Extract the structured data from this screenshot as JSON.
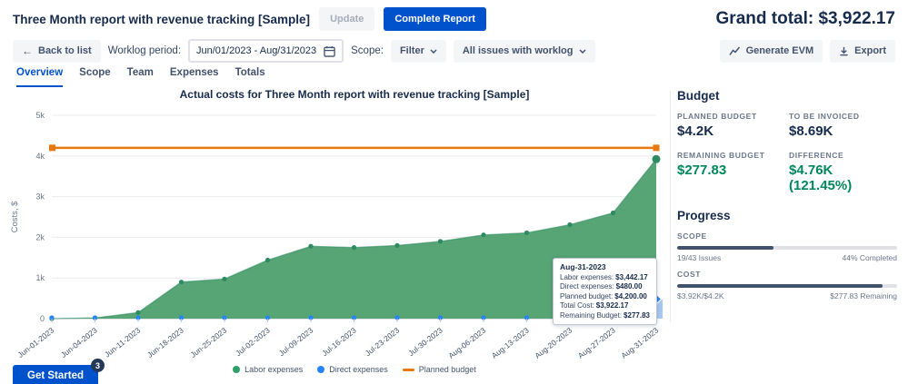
{
  "header": {
    "title": "Three Month report with revenue tracking [Sample]",
    "update_label": "Update",
    "complete_label": "Complete Report",
    "grand_total": "Grand total: $3,922.17"
  },
  "toolbar": {
    "back_label": "Back to list",
    "back_arrow": "←",
    "worklog_label": "Worklog period:",
    "worklog_value": "Jun/01/2023 - Aug/31/2023",
    "scope_label": "Scope:",
    "filter_value": "Filter",
    "issues_value": "All issues with worklog",
    "generate_evm_label": "Generate EVM",
    "export_label": "Export"
  },
  "tabs": [
    {
      "label": "Overview"
    },
    {
      "label": "Scope"
    },
    {
      "label": "Team"
    },
    {
      "label": "Expenses"
    },
    {
      "label": "Totals"
    }
  ],
  "chart_data": {
    "type": "area",
    "title": "Actual costs for Three Month report with revenue tracking [Sample]",
    "ylabel": "Costs, $",
    "xlabel": "",
    "ylim": [
      0,
      5000
    ],
    "yticks": [
      "0",
      "1k",
      "2k",
      "3k",
      "4k",
      "5k"
    ],
    "grid": true,
    "legend_position": "bottom",
    "x": [
      "Jun-01-2023",
      "Jun-04-2023",
      "Jun-11-2023",
      "Jun-18-2023",
      "Jun-25-2023",
      "Jul-02-2023",
      "Jul-09-2023",
      "Jul-16-2023",
      "Jul-23-2023",
      "Jul-30-2023",
      "Aug-06-2023",
      "Aug-13-2023",
      "Aug-20-2023",
      "Aug-27-2023",
      "Aug-31-2023"
    ],
    "series": [
      {
        "name": "Labor expenses",
        "type": "area",
        "color": "#57A475",
        "point_color": "#2E8B61",
        "values": [
          0,
          20,
          150,
          900,
          975,
          1440,
          1780,
          1750,
          1800,
          1900,
          2060,
          2110,
          2310,
          2600,
          3922
        ]
      },
      {
        "name": "Direct expenses",
        "type": "scatter",
        "color": "#2684FF",
        "bar_color": "#A6C8F0",
        "values": [
          0,
          0,
          0,
          0,
          0,
          0,
          0,
          0,
          0,
          0,
          0,
          0,
          0,
          0,
          480
        ]
      },
      {
        "name": "Planned budget",
        "type": "line",
        "color": "#E8770D",
        "values": [
          4200,
          4200,
          4200,
          4200,
          4200,
          4200,
          4200,
          4200,
          4200,
          4200,
          4200,
          4200,
          4200,
          4200,
          4200
        ]
      }
    ]
  },
  "tooltip": {
    "date": "Aug-31-2023",
    "lines": [
      {
        "label": "Labor expenses:",
        "value": "$3,442.17"
      },
      {
        "label": "Direct expenses:",
        "value": "$480.00"
      },
      {
        "label": "Planned budget:",
        "value": "$4,200.00"
      },
      {
        "label": "Total Cost:",
        "value": "$3,922.17"
      },
      {
        "label": "Remaining Budget:",
        "value": "$277.83"
      }
    ]
  },
  "legend": [
    {
      "label": "Labor expenses",
      "color": "#2E9E69"
    },
    {
      "label": "Direct expenses",
      "color": "#2684FF"
    },
    {
      "label": "Planned budget",
      "color": "#E8770D"
    }
  ],
  "sidebar": {
    "budget_title": "Budget",
    "budget_items": [
      {
        "label": "PLANNED BUDGET",
        "value": "$4.2K"
      },
      {
        "label": "TO BE INVOICED",
        "value": "$8.69K"
      },
      {
        "label": "REMAINING BUDGET",
        "value": "$277.83"
      },
      {
        "label": "DIFFERENCE",
        "value": "$4.76K (121.45%)"
      }
    ],
    "progress_title": "Progress",
    "scope": {
      "label": "SCOPE",
      "pct": 44,
      "left": "19/43 Issues",
      "right": "44% Completed"
    },
    "cost": {
      "label": "COST",
      "pct": 93.4,
      "left": "$3.92K/$4.2K",
      "right": "$277.83 Remaining"
    }
  },
  "get_started": {
    "label": "Get Started",
    "badge": "3"
  },
  "colors": {
    "accent": "#0052CC",
    "positive": "#00875A",
    "progress_fill": "#42526E"
  }
}
